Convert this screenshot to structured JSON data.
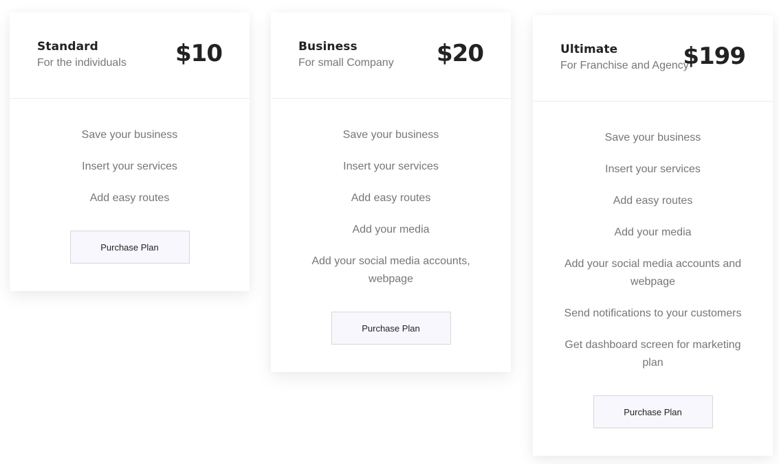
{
  "plans": [
    {
      "name": "Standard",
      "subtitle": "For the individuals",
      "price": "$10",
      "features": [
        "Save your business",
        "Insert your services",
        "Add easy routes"
      ],
      "button_label": "Purchase Plan"
    },
    {
      "name": "Business",
      "subtitle": "For small Company",
      "price": "$20",
      "features": [
        "Save your business",
        "Insert your services",
        "Add easy routes",
        "Add your media",
        "Add your social media accounts, webpage"
      ],
      "button_label": "Purchase Plan"
    },
    {
      "name": "Ultimate",
      "subtitle": "For Franchise and Agency",
      "price": "$199",
      "features": [
        "Save your business",
        "Insert your services",
        "Add easy routes",
        "Add your media",
        "Add your social media accounts and webpage",
        "Send notifications to your customers",
        "Get dashboard screen for marketing plan"
      ],
      "button_label": "Purchase Plan"
    }
  ]
}
